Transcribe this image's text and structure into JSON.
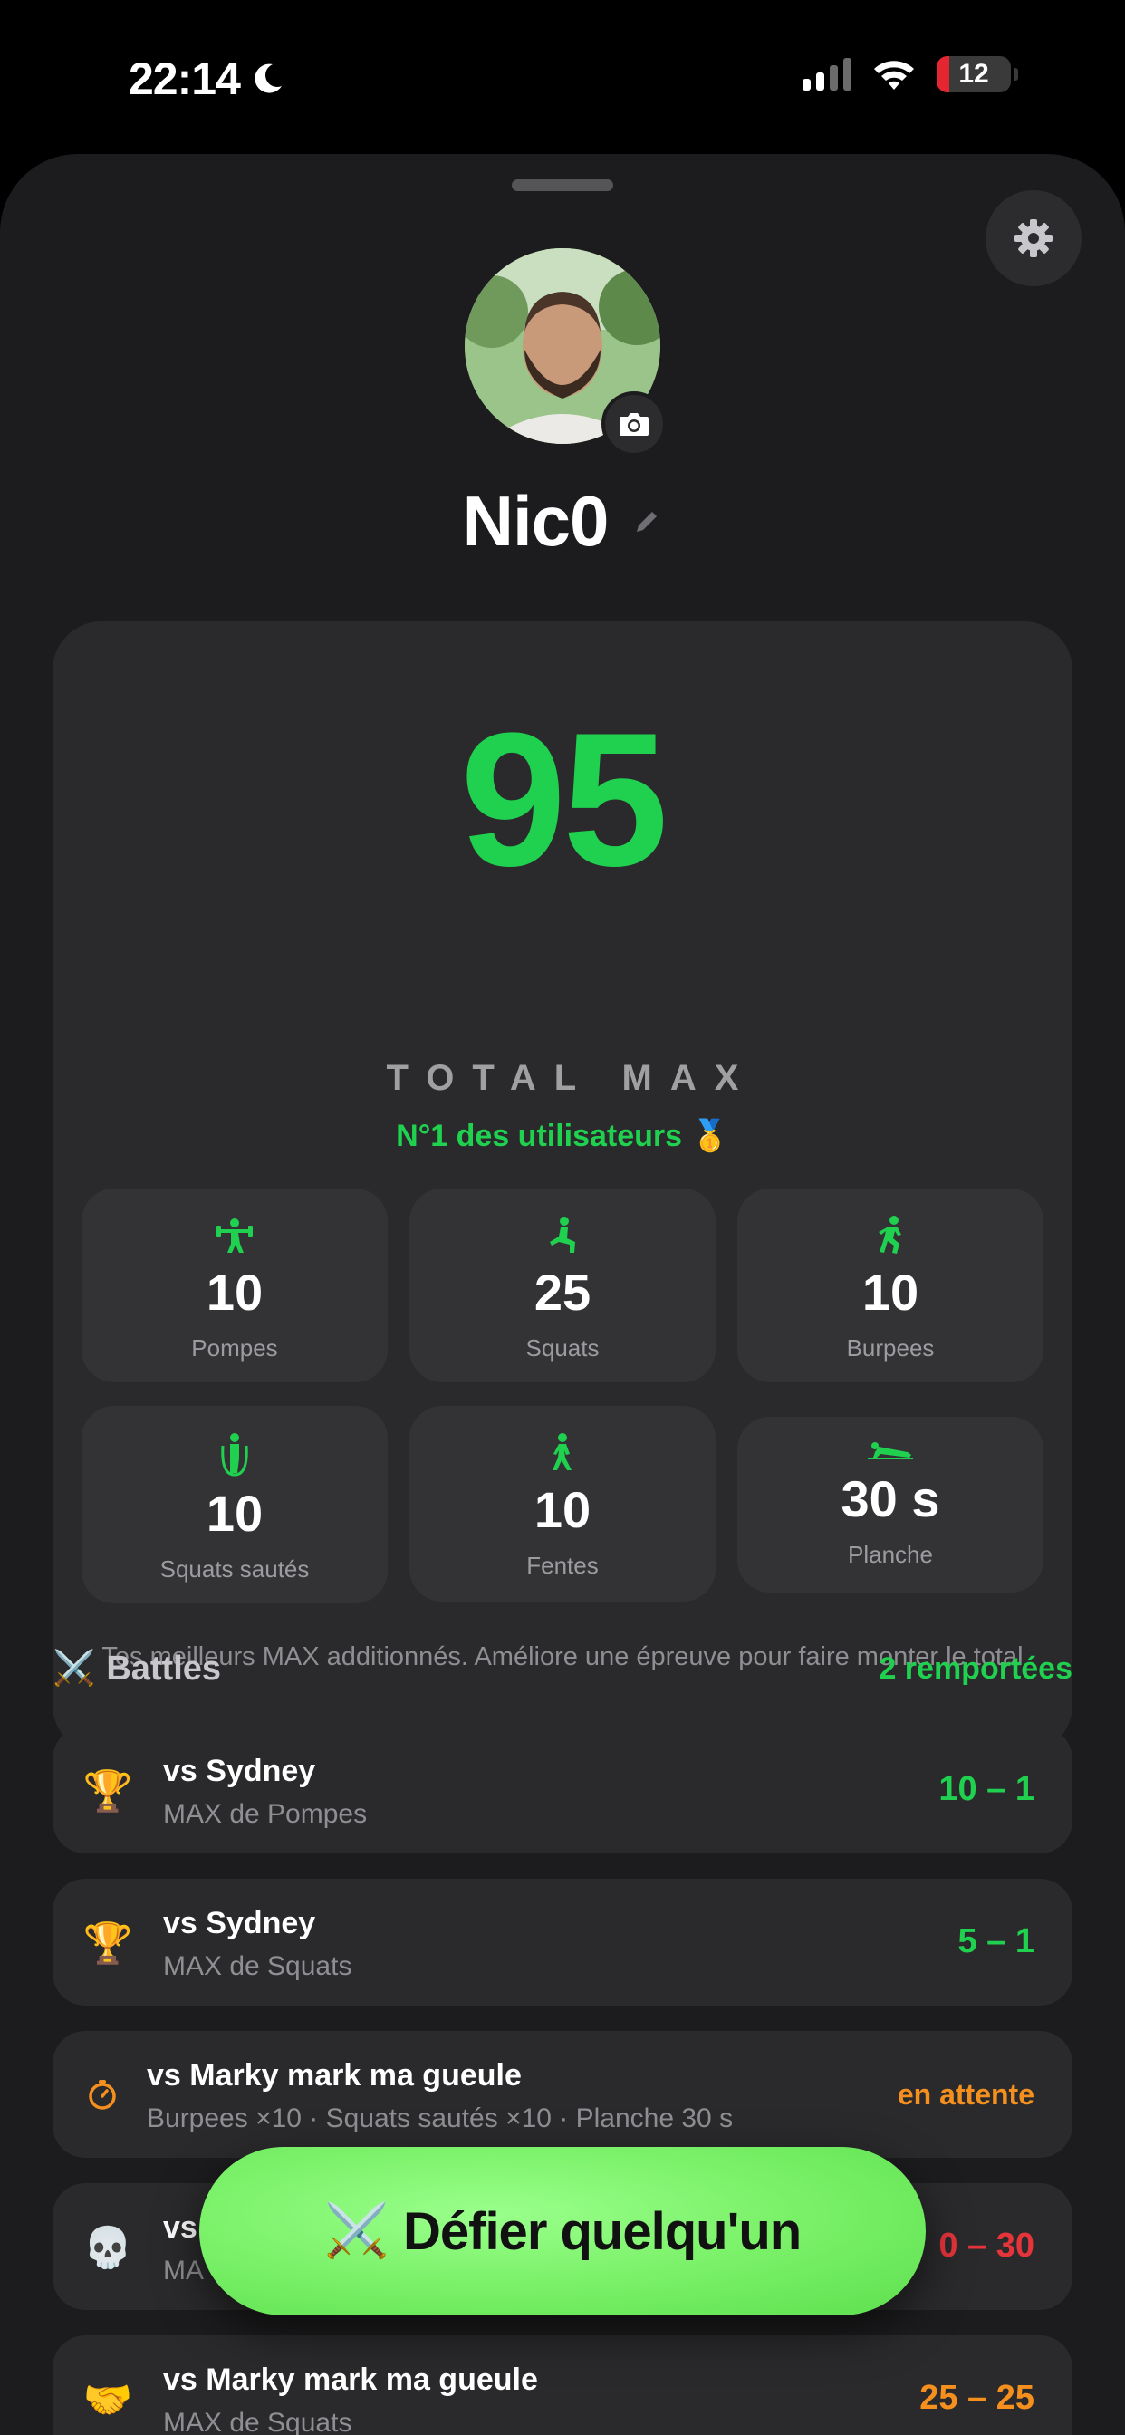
{
  "status_bar": {
    "time": "22:14",
    "battery_percent": "12",
    "icons": [
      "moon-icon",
      "cellular-signal-icon",
      "wifi-icon",
      "battery-icon"
    ]
  },
  "profile": {
    "name": "Nic0",
    "icons": [
      "gear-icon",
      "camera-icon",
      "pencil-icon"
    ]
  },
  "total": {
    "value": "95",
    "label": "TOTAL MAX",
    "rank": "N°1 des utilisateurs 🥇",
    "note": "Tes meilleurs MAX additionnés. Améliore une épreuve pour faire monter le total"
  },
  "exercises": [
    {
      "value": "10",
      "label": "Pompes",
      "icon": "weightlifter-icon"
    },
    {
      "value": "25",
      "label": "Squats",
      "icon": "squat-icon"
    },
    {
      "value": "10",
      "label": "Burpees",
      "icon": "runner-icon"
    },
    {
      "value": "10",
      "label": "Squats sautés",
      "icon": "jump-rope-icon"
    },
    {
      "value": "10",
      "label": "Fentes",
      "icon": "walker-icon"
    },
    {
      "value": "30 s",
      "label": "Planche",
      "icon": "plank-icon"
    }
  ],
  "battles": {
    "title": "Battles",
    "title_emoji": "⚔️",
    "won_count": "2 remportées",
    "items": [
      {
        "icon": "🏆",
        "title": "vs Sydney",
        "subtitle": "MAX de Pompes",
        "score": "10 – 1",
        "status": "won"
      },
      {
        "icon": "🏆",
        "title": "vs Sydney",
        "subtitle": "MAX de Squats",
        "score": "5 – 1",
        "status": "won"
      },
      {
        "icon": "timer",
        "title": "vs Marky mark ma gueule",
        "subtitle": "Burpees ×10 · Squats sautés ×10 · Planche 30 s",
        "score": "en attente",
        "status": "pending"
      },
      {
        "icon": "💀",
        "title": "vs",
        "subtitle": "MA",
        "score": "0 – 30",
        "status": "lost"
      },
      {
        "icon": "🤝",
        "title": "vs Marky mark ma gueule",
        "subtitle": "MAX de Squats",
        "score": "25 – 25",
        "status": "draw"
      }
    ]
  },
  "cta": {
    "emoji": "⚔️",
    "label": "Défier quelqu'un"
  },
  "colors": {
    "accent_green": "#1fd14f",
    "pending_orange": "#f5901e",
    "lost_red": "#e5343a",
    "draw_orange": "#f5901e",
    "cta_green": "#7df26b"
  }
}
